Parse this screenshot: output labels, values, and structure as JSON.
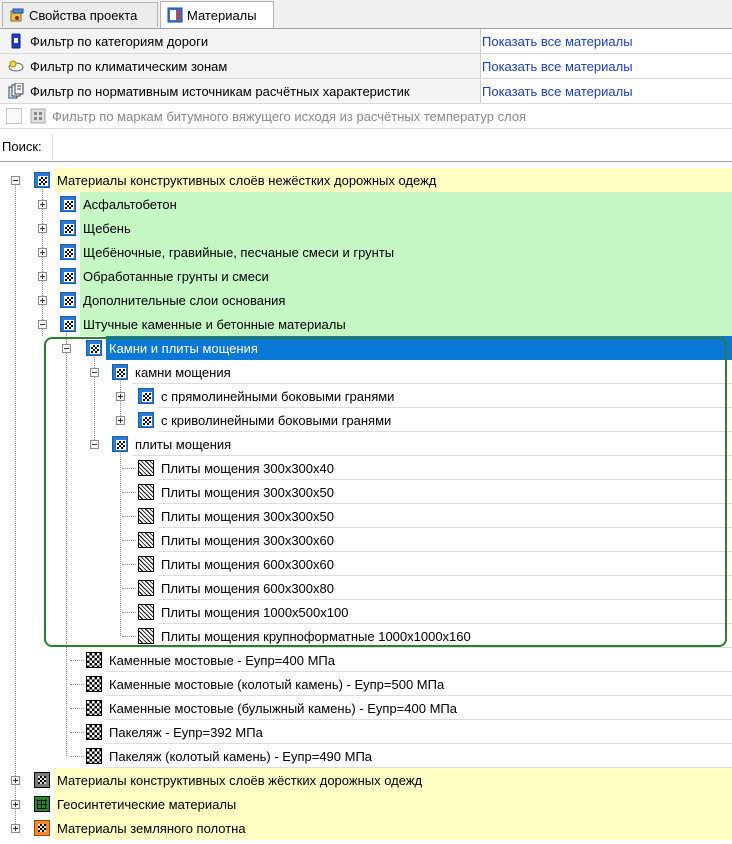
{
  "tabs": [
    {
      "label": "Свойства проекта",
      "icon": "project-properties-icon"
    },
    {
      "label": "Материалы",
      "icon": "materials-icon",
      "active": true
    }
  ],
  "filters": [
    {
      "label": "Фильтр по категориям дороги",
      "link": "Показать все материалы",
      "icon": "road-category-icon"
    },
    {
      "label": "Фильтр по климатическим зонам",
      "link": "Показать все материалы",
      "icon": "climate-zone-icon"
    },
    {
      "label": "Фильтр по нормативным источникам расчётных характеристик",
      "link": "Показать все материалы",
      "icon": "normative-sources-icon"
    },
    {
      "label": "Фильтр по маркам битумного вяжущего исходя из расчётных температур слоя",
      "disabled": true,
      "icon": "bitumen-icon"
    }
  ],
  "search": {
    "label": "Поиск:",
    "value": "",
    "placeholder": ""
  },
  "tree": [
    {
      "label": "Материалы конструктивных слоёв нежёстких дорожных одежд",
      "level": 0,
      "expander": "minus",
      "bg": "yellow",
      "icon": "flexible-materials-icon"
    },
    {
      "label": "Асфальтобетон",
      "level": 1,
      "expander": "plus",
      "bg": "green",
      "icon": "folder-icon"
    },
    {
      "label": "Щебень",
      "level": 1,
      "expander": "plus",
      "bg": "green",
      "icon": "folder-icon"
    },
    {
      "label": "Щебёночные, гравийные, песчаные смеси и грунты",
      "level": 1,
      "expander": "plus",
      "bg": "green",
      "icon": "folder-icon"
    },
    {
      "label": "Обработанные грунты и смеси",
      "level": 1,
      "expander": "plus",
      "bg": "green",
      "icon": "folder-icon"
    },
    {
      "label": "Дополнительные слои основания",
      "level": 1,
      "expander": "plus",
      "bg": "green",
      "icon": "folder-icon"
    },
    {
      "label": "Штучные каменные и бетонные материалы",
      "level": 1,
      "expander": "minus",
      "bg": "green",
      "icon": "folder-icon"
    },
    {
      "label": "Камни и плиты мощения",
      "level": 2,
      "expander": "minus",
      "bg": "selected",
      "icon": "folder-icon"
    },
    {
      "label": "камни мощения",
      "level": 3,
      "expander": "minus",
      "bg": "white",
      "icon": "folder-icon"
    },
    {
      "label": "с прямолинейными боковыми гранями",
      "level": 4,
      "expander": "plus",
      "bg": "white",
      "icon": "folder-icon"
    },
    {
      "label": "с криволинейными боковыми гранями",
      "level": 4,
      "expander": "plus",
      "bg": "white",
      "icon": "folder-icon"
    },
    {
      "label": "плиты мощения",
      "level": 3,
      "expander": "minus",
      "bg": "white",
      "icon": "folder-icon"
    },
    {
      "label": "Плиты мощения 300x300x40",
      "level": 4,
      "bg": "white",
      "icon": "paving-slab-icon"
    },
    {
      "label": "Плиты мощения 300x300x50",
      "level": 4,
      "bg": "white",
      "icon": "paving-slab-icon"
    },
    {
      "label": "Плиты мощения 300x300x50",
      "level": 4,
      "bg": "white",
      "icon": "paving-slab-icon"
    },
    {
      "label": "Плиты мощения 300x300x60",
      "level": 4,
      "bg": "white",
      "icon": "paving-slab-icon"
    },
    {
      "label": "Плиты мощения 600x300x60",
      "level": 4,
      "bg": "white",
      "icon": "paving-slab-icon"
    },
    {
      "label": "Плиты мощения 600x300x80",
      "level": 4,
      "bg": "white",
      "icon": "paving-slab-icon"
    },
    {
      "label": "Плиты мощения 1000x500x100",
      "level": 4,
      "bg": "white",
      "icon": "paving-slab-icon"
    },
    {
      "label": "Плиты мощения крупноформатные 1000x1000x160",
      "level": 4,
      "bg": "white",
      "icon": "paving-slab-icon"
    },
    {
      "label": "Каменные мостовые - Eупр=400 МПа",
      "level": 2,
      "bg": "white",
      "icon": "checkered-material-icon"
    },
    {
      "label": "Каменные мостовые (колотый камень) - Eупр=500 МПа",
      "level": 2,
      "bg": "white",
      "icon": "checkered-material-icon"
    },
    {
      "label": "Каменные мостовые (булыжный камень) - Eупр=400 МПа",
      "level": 2,
      "bg": "white",
      "icon": "checkered-material-icon"
    },
    {
      "label": "Пакеляж - Eупр=392 МПа",
      "level": 2,
      "bg": "white",
      "icon": "checkered-material-icon"
    },
    {
      "label": "Пакеляж (колотый камень) - Eупр=490 МПа",
      "level": 2,
      "bg": "white",
      "icon": "checkered-material-icon"
    },
    {
      "label": "Материалы конструктивных слоёв жёстких дорожных одежд",
      "level": 0,
      "expander": "plus",
      "bg": "yellow",
      "icon": "rigid-materials-icon"
    },
    {
      "label": "Геосинтетические материалы",
      "level": 0,
      "expander": "plus",
      "bg": "yellow",
      "icon": "geosynthetics-icon"
    },
    {
      "label": "Материалы земляного полотна",
      "level": 0,
      "expander": "plus",
      "bg": "yellow",
      "icon": "subgrade-materials-icon"
    }
  ],
  "colors": {
    "link": "#1a3fc9",
    "yellow_row": "#ffffc4",
    "green_row": "#c4f7c4",
    "selected_row": "#0a78d7",
    "highlight_box": "#2f7d32"
  }
}
